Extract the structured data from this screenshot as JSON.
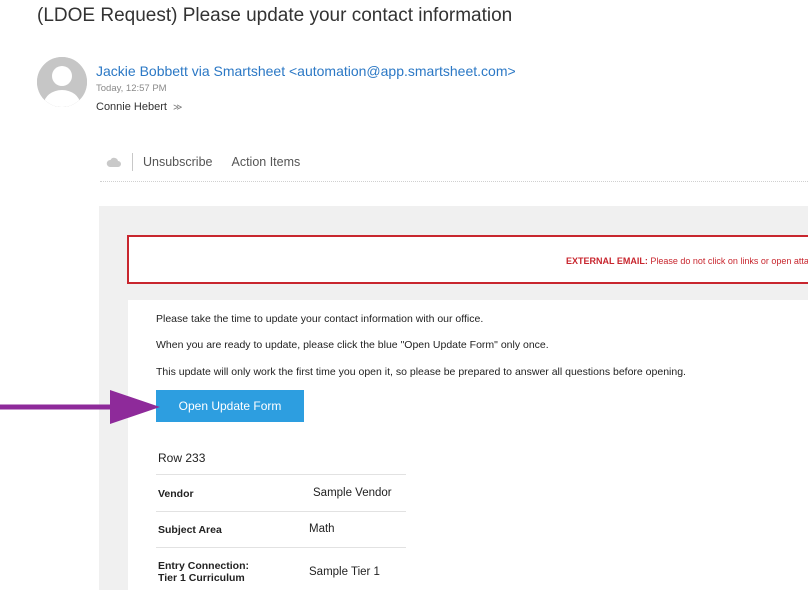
{
  "email": {
    "subject": "(LDOE Request) Please update your contact information",
    "sender": "Jackie Bobbett via Smartsheet <automation@app.smartsheet.com>",
    "time": "Today, 12:57 PM",
    "recipient": "Connie Hebert",
    "recipient_chevron": "≫"
  },
  "action_bar": {
    "icon": "cloud-icon",
    "unsubscribe": "Unsubscribe",
    "action_items": "Action Items"
  },
  "warning": {
    "label": "EXTERNAL EMAIL:",
    "text": " Please do not click on links or open attachments unless you know the content is safe."
  },
  "body": {
    "line1": "Please take the time to update your contact information with our office.",
    "line2": "When you are ready to update, please click the blue \"Open Update Form\" only once.",
    "line3": "This update will only work the first time you open it, so please be prepared to answer all questions before opening.",
    "button_label": "Open Update Form",
    "row_title": "Row 233",
    "rows": [
      {
        "label": "Vendor",
        "value": "Sample Vendor"
      },
      {
        "label": "Subject Area",
        "value": "Math"
      },
      {
        "label_line1": "Entry Connection:",
        "label_line2": "Tier 1 Curriculum",
        "value": "Sample Tier 1"
      }
    ]
  },
  "colors": {
    "link_blue": "#2b78c5",
    "button_blue": "#2d9ee0",
    "warning_red": "#c8262e",
    "arrow_purple": "#8e2a9a"
  }
}
